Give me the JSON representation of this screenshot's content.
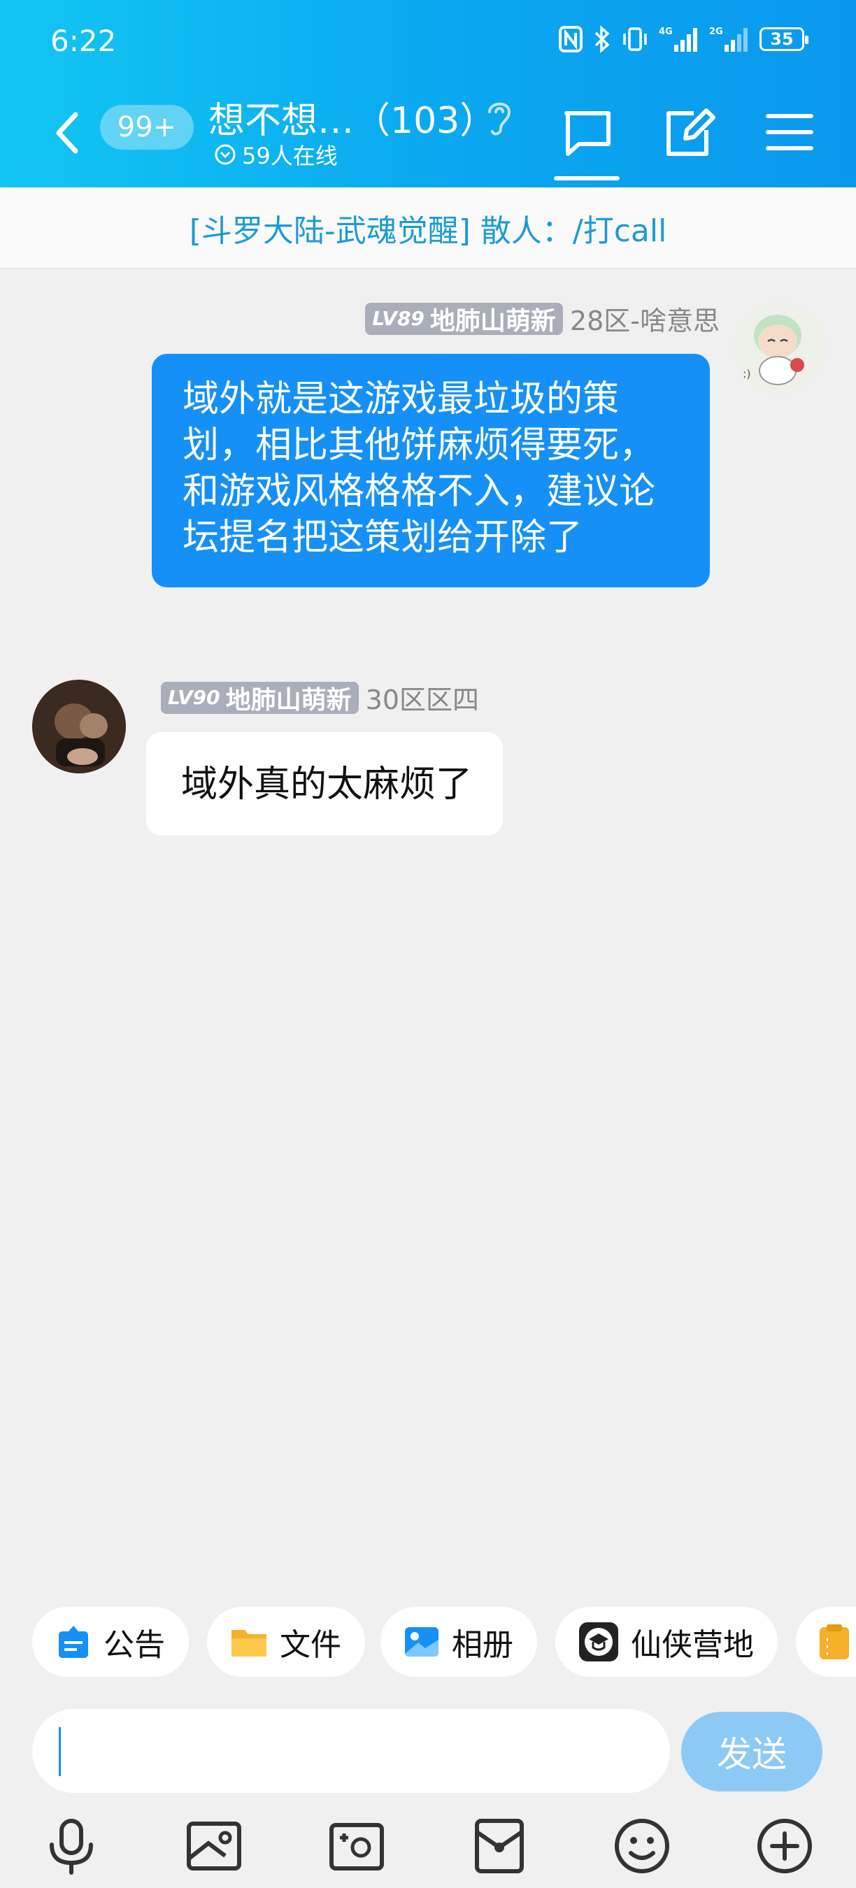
{
  "status_bar": {
    "time": "6:22",
    "battery": "35",
    "network_1": "4G",
    "network_2": "2G"
  },
  "header": {
    "unread_count": "99+",
    "group_title": "想不想…（103）",
    "online_status": "59人在线"
  },
  "notice": {
    "text": "[斗罗大陆-武魂觉醒] 散人：/打call"
  },
  "messages": [
    {
      "side": "right",
      "level": "LV89",
      "title": "地肺山萌新",
      "tag": "28区-啥意思",
      "text": "域外就是这游戏最垃圾的策划，相比其他饼麻烦得要死，和游戏风格格格不入，建议论坛提名把这策划给开除了"
    },
    {
      "side": "left",
      "level": "LV90",
      "title": "地肺山萌新",
      "tag": "30区区四",
      "text": "域外真的太麻烦了"
    }
  ],
  "quick_actions": [
    {
      "label": "公告",
      "icon": "announcement-icon"
    },
    {
      "label": "文件",
      "icon": "folder-icon"
    },
    {
      "label": "相册",
      "icon": "album-icon"
    },
    {
      "label": "仙侠营地",
      "icon": "camp-icon"
    }
  ],
  "composer": {
    "input_value": "",
    "send_label": "发送"
  },
  "toolbar": [
    "microphone-icon",
    "image-icon",
    "camera-icon",
    "red-packet-icon",
    "emoji-icon",
    "plus-icon"
  ],
  "colors": {
    "header_start": "#12c6f3",
    "header_end": "#0a98ee",
    "my_bubble": "#1590f6",
    "send_button": "#8ccaf5",
    "notice_text": "#1c9cd4"
  }
}
